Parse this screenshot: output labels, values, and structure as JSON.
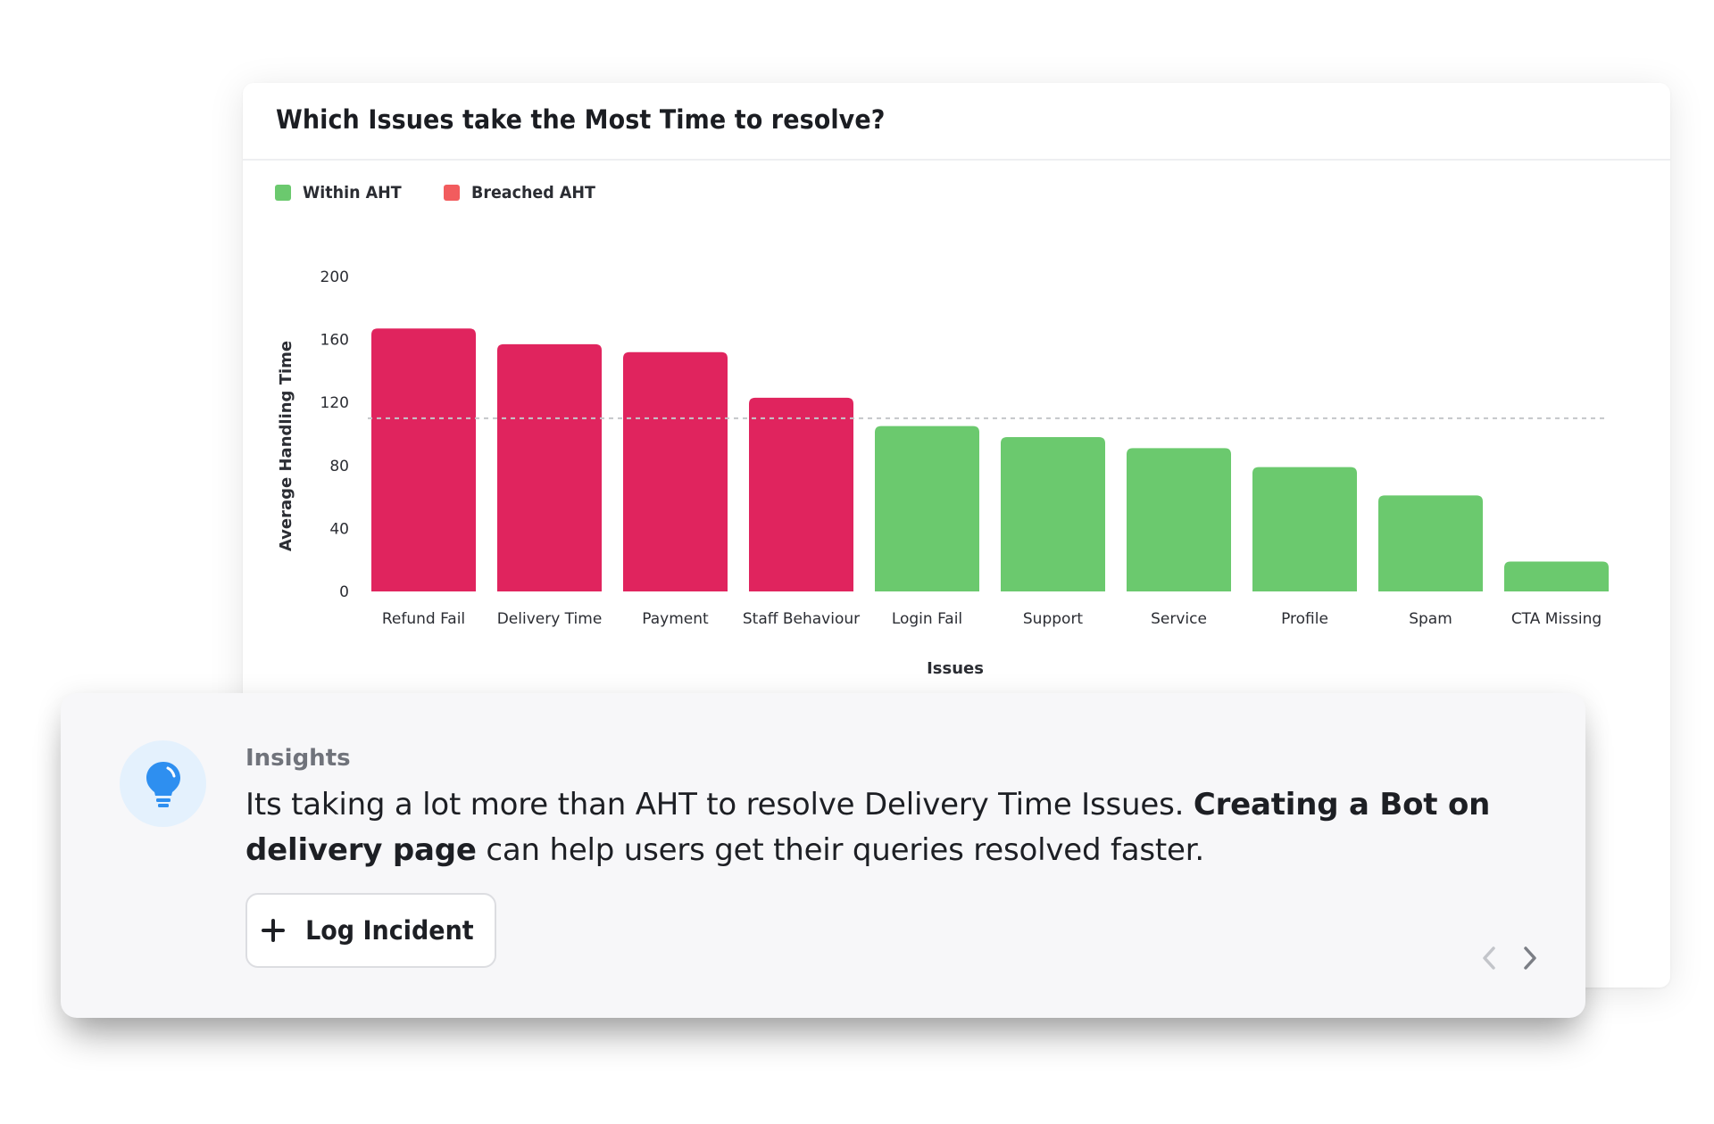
{
  "card": {
    "title": "Which Issues take the Most Time to resolve?"
  },
  "legend": [
    {
      "label": "Within AHT",
      "color": "#6BC96E"
    },
    {
      "label": "Breached AHT",
      "color": "#F25C5E"
    }
  ],
  "colors": {
    "within": "#6BC96E",
    "breached": "#E0245E",
    "threshold_line": "#C4C6CA",
    "insight_icon": "#2E8FF0",
    "insight_icon_bg": "#E4F1FD"
  },
  "chart_data": {
    "type": "bar",
    "title": "Which Issues take the Most Time to resolve?",
    "xlabel": "Issues",
    "ylabel": "Average Handling Time",
    "ylim": [
      0,
      200
    ],
    "yticks": [
      0,
      40,
      80,
      120,
      160,
      200
    ],
    "grid": false,
    "legend_position": "top-left",
    "aht_threshold": 110,
    "categories": [
      "Refund Fail",
      "Delivery Time",
      "Payment",
      "Staff Behaviour",
      "Login Fail",
      "Support",
      "Service",
      "Profile",
      "Spam",
      "CTA Missing"
    ],
    "values": [
      167,
      157,
      152,
      123,
      105,
      98,
      91,
      79,
      61,
      19
    ],
    "status": [
      "Breached AHT",
      "Breached AHT",
      "Breached AHT",
      "Breached AHT",
      "Within AHT",
      "Within AHT",
      "Within AHT",
      "Within AHT",
      "Within AHT",
      "Within AHT"
    ]
  },
  "insight": {
    "heading": "Insights",
    "text_part1": "Its taking a lot more than AHT to resolve Delivery Time Issues. ",
    "text_bold": "Creating a Bot on delivery page",
    "text_part2": " can help users get their queries resolved faster.",
    "icon": "lightbulb-icon",
    "button_label": "Log Incident",
    "button_icon": "plus-icon",
    "prev_icon": "chevron-left-icon",
    "next_icon": "chevron-right-icon"
  }
}
